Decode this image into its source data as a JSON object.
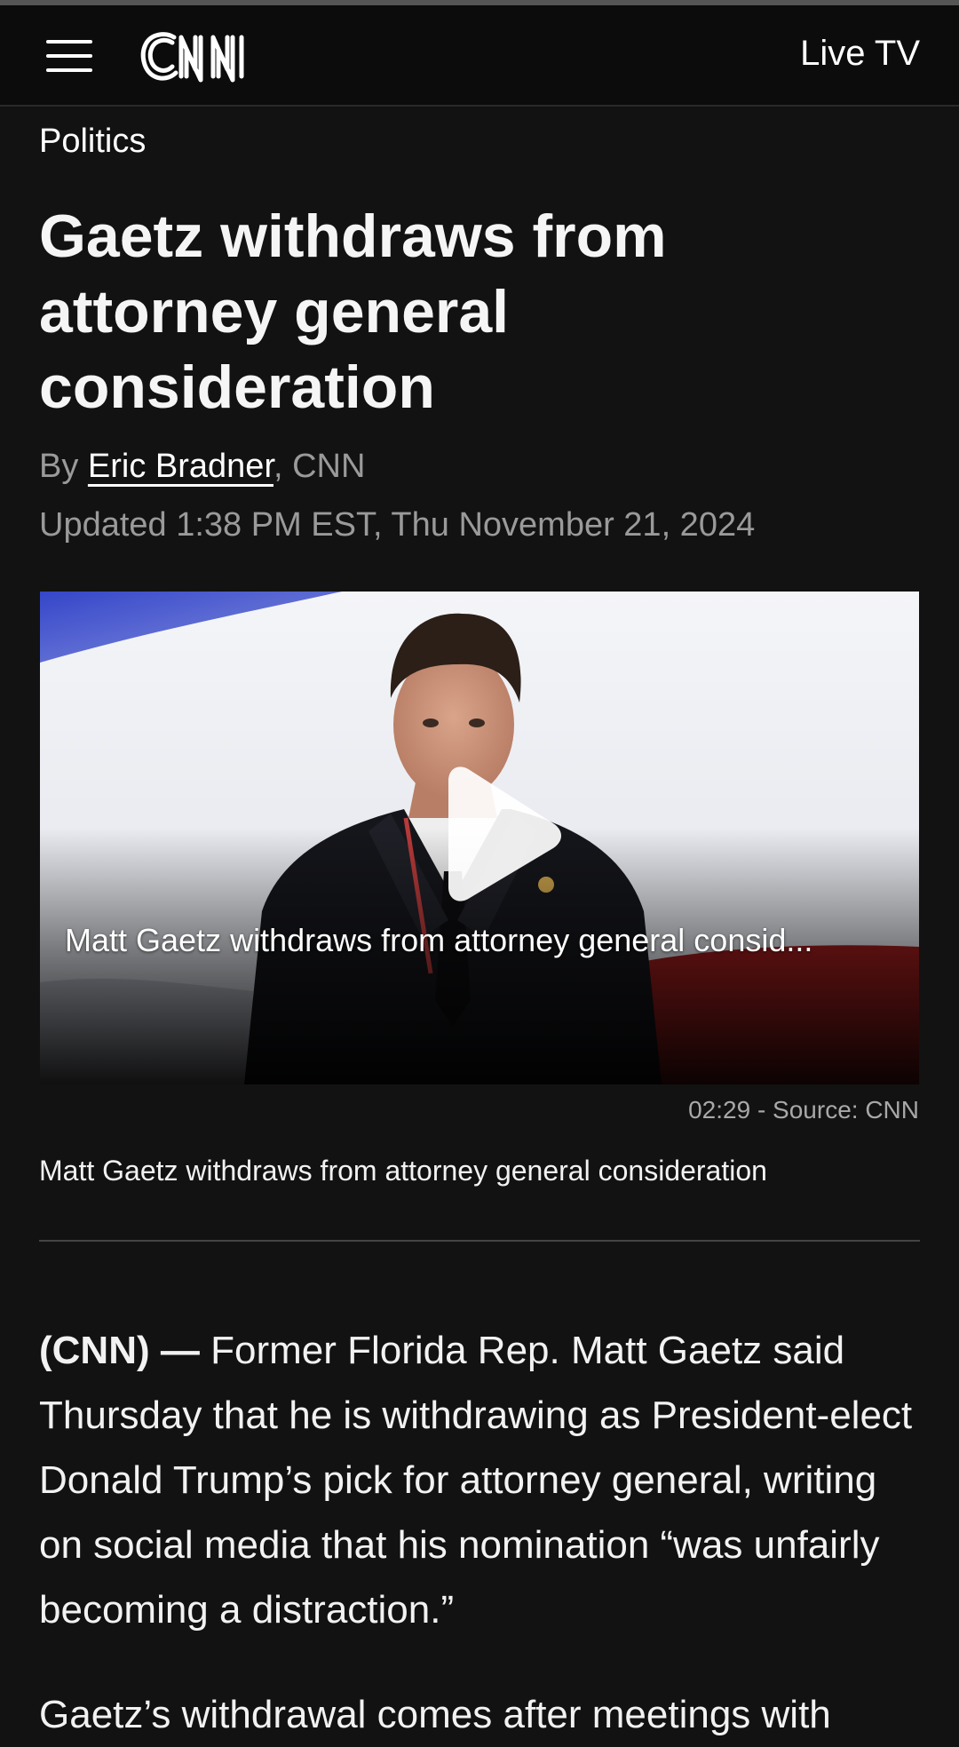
{
  "header": {
    "logo_text": "CNN",
    "live_tv_label": "Live TV"
  },
  "article": {
    "section": "Politics",
    "headline": "Gaetz withdraws from attorney general consideration",
    "byline_prefix": "By ",
    "author": "Eric Bradner",
    "byline_suffix": ", CNN",
    "updated": "Updated 1:38 PM EST, Thu November 21, 2024"
  },
  "video": {
    "overlay_title": "Matt Gaetz withdraws from attorney general consid...",
    "duration_source": "02:29 - Source: CNN",
    "caption": "Matt Gaetz withdraws from attorney general consideration"
  },
  "body": {
    "dateline": "(CNN) — ",
    "paragraph1": "Former Florida Rep. Matt Gaetz said Thursday that he is withdrawing as President-elect Donald Trump’s pick for attorney general, writing on social media that his nomination “was unfairly becoming a distraction.”",
    "paragraph2": "Gaetz’s withdrawal comes after meetings with"
  },
  "colors": {
    "background": "#121212",
    "header": "#0c0c0c",
    "text": "#f2f2f2",
    "muted": "#9a9a9a"
  },
  "icons": {
    "menu": "hamburger-menu-icon",
    "play": "play-icon"
  }
}
